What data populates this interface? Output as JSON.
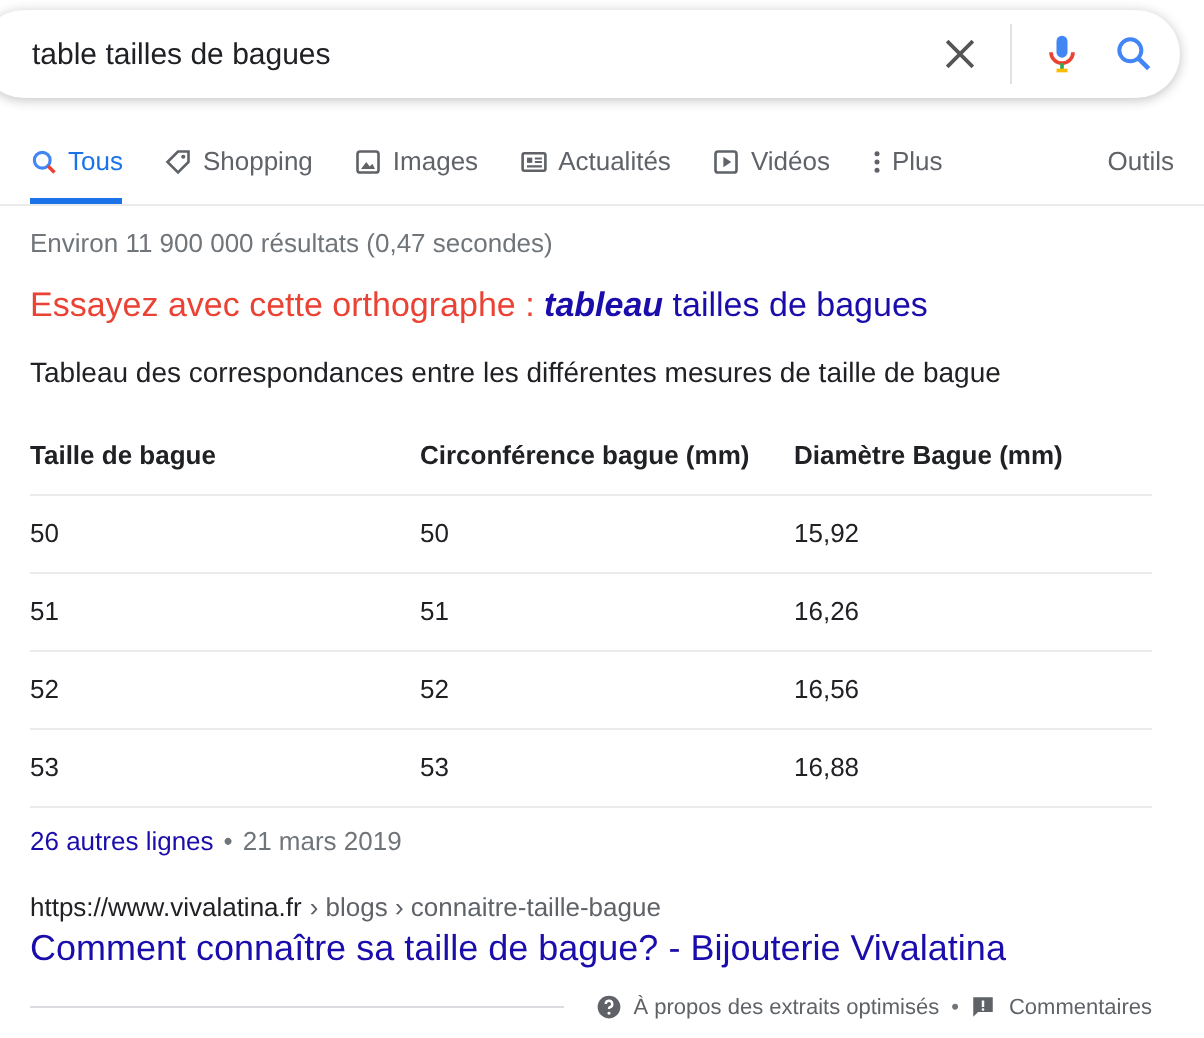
{
  "search": {
    "value": "table tailles de bagues"
  },
  "tabs": [
    {
      "label": "Tous",
      "kind": "all",
      "selected": true
    },
    {
      "label": "Shopping",
      "kind": "shopping",
      "selected": false
    },
    {
      "label": "Images",
      "kind": "images",
      "selected": false
    },
    {
      "label": "Actualités",
      "kind": "news",
      "selected": false
    },
    {
      "label": "Vidéos",
      "kind": "videos",
      "selected": false
    },
    {
      "label": "Plus",
      "kind": "more",
      "selected": false
    }
  ],
  "tools": "Outils",
  "stats": "Environ 11 900 000 résultats (0,47 secondes)",
  "spelling": {
    "prompt": "Essayez avec cette orthographe :",
    "suggestion": "**tableau** tailles de bagues"
  },
  "snippet": "Tableau des correspondances entre les différentes mesures de taille de bague",
  "table": {
    "columns": [
      "Taille de bague",
      "Circonférence bague (mm)",
      "Diamètre Bague (mm)"
    ],
    "rows": [
      [
        "50",
        "50",
        "15,92"
      ],
      [
        "51",
        "51",
        "16,26"
      ],
      [
        "52",
        "52",
        "16,56"
      ],
      [
        "53",
        "53",
        "16,88"
      ]
    ]
  },
  "more_rows": {
    "link": "26 autres lignes",
    "separator": "•",
    "date": "21 mars 2019"
  },
  "result": {
    "url": "https://www.vivalatina.fr",
    "path": "› blogs › connaitre-taille-bague",
    "title": "Comment connaître sa taille de bague? - Bijouterie Vivalatina"
  },
  "footer": {
    "about": "À propos des extraits optimisés",
    "separator": "•",
    "feedback": "Commentaires"
  }
}
